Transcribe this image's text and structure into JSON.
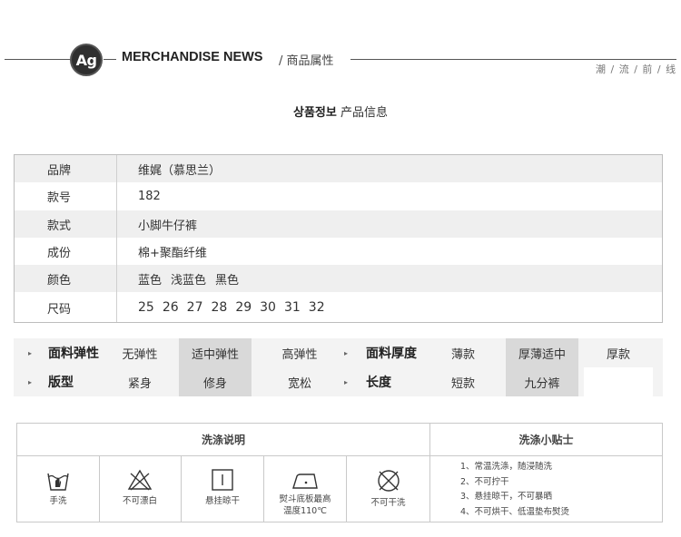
{
  "header": {
    "logo_text": "Ag",
    "title": "MERCHANDISE NEWS",
    "subtitle": "/ 商品属性",
    "right_text": "潮 / 流 / 前 / 线"
  },
  "section": {
    "title_bold": "상품정보",
    "title_rest": " 产品信息"
  },
  "info": {
    "rows": [
      {
        "key": "品牌",
        "value": "维娓（慕思兰）"
      },
      {
        "key": "款号",
        "value": "182"
      },
      {
        "key": "款式",
        "value": "小脚牛仔裤"
      },
      {
        "key": "成份",
        "value": "棉+聚酯纤维"
      },
      {
        "key": "颜色",
        "values": [
          "蓝色",
          "浅蓝色",
          "黑色"
        ]
      },
      {
        "key": "尺码",
        "values": [
          "25",
          "26",
          "27",
          "28",
          "29",
          "30",
          "31",
          "32"
        ]
      }
    ]
  },
  "attributes": {
    "row1": {
      "label_a": "面料弹性",
      "options_a": [
        "无弹性",
        "适中弹性",
        "高弹性"
      ],
      "selected_a": "适中弹性",
      "label_b": "面料厚度",
      "options_b": [
        "薄款",
        "厚薄适中",
        "厚款"
      ],
      "selected_b": "厚薄适中"
    },
    "row2": {
      "label_a": "版型",
      "options_a": [
        "紧身",
        "修身",
        "宽松"
      ],
      "selected_a": "修身",
      "label_b": "长度",
      "options_b": [
        "短款",
        "九分裤"
      ],
      "selected_b": "九分裤"
    },
    "arrow_glyph": "▸"
  },
  "washing": {
    "instructions_title": "洗涤说明",
    "tips_title": "洗涤小贴士",
    "icons": [
      {
        "icon": "hand-wash-icon",
        "caption": "手洗"
      },
      {
        "icon": "no-bleach-icon",
        "caption": "不可漂白"
      },
      {
        "icon": "hang-dry-icon",
        "caption": "悬挂晾干"
      },
      {
        "icon": "iron-icon",
        "caption_line1": "熨斗底板最高",
        "caption_line2": "温度110℃"
      },
      {
        "icon": "no-dry-clean-icon",
        "caption": "不可干洗"
      }
    ],
    "tips": [
      "1、常温洗涤，随浸随洗",
      "2、不可拧干",
      "3、悬挂晾干，不可暴晒",
      "4、不可烘干、低温垫布熨烫"
    ]
  }
}
